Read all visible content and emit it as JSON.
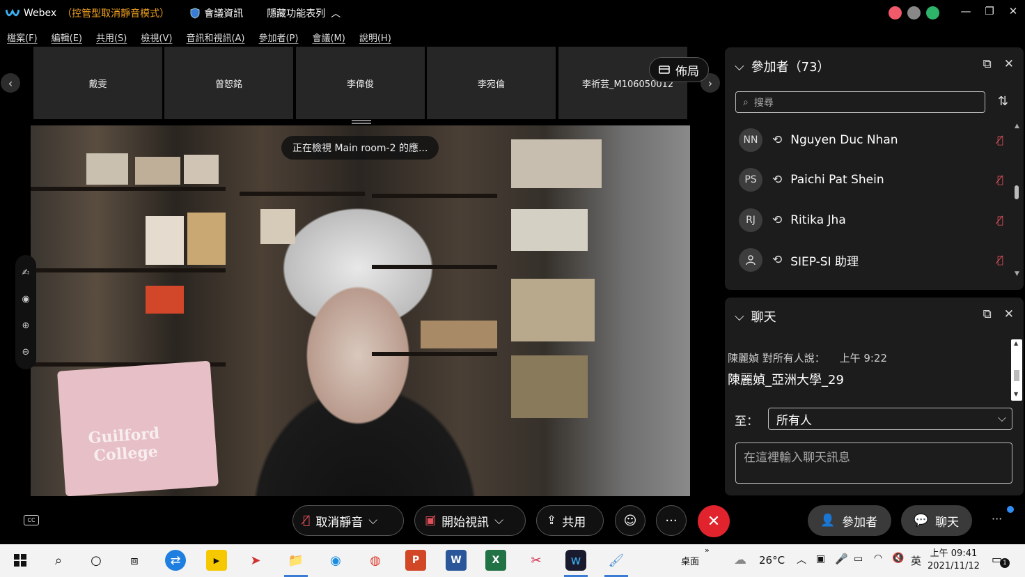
{
  "titlebar": {
    "app_name": "Webex",
    "mode": "（控管型取消靜音模式）",
    "meeting_info": "會議資訊",
    "hide_toolbar": "隱藏功能表列"
  },
  "menu": [
    "檔案(F)",
    "編輯(E)",
    "共用(S)",
    "檢視(V)",
    "音訊和視訊(A)",
    "參加者(P)",
    "會議(M)",
    "說明(H)"
  ],
  "thumbnails": [
    "戴雯",
    "曾恕銘",
    "李偉俊",
    "李宛倫",
    "李祈芸_M106050012"
  ],
  "layout_label": "佈局",
  "viewing_tip": "正在檢視 Main room-2 的應...",
  "video": {
    "shirt_line1": "Guilford",
    "shirt_line2": "College"
  },
  "participants": {
    "title": "參加者（73）",
    "search_placeholder": "搜尋",
    "list": [
      {
        "initials": "NN",
        "name": "Nguyen Duc Nhan"
      },
      {
        "initials": "PS",
        "name": "Paichi Pat Shein"
      },
      {
        "initials": "RJ",
        "name": "Ritika Jha"
      },
      {
        "initials": "",
        "name": "SIEP-SI 助理"
      }
    ]
  },
  "chat": {
    "title": "聊天",
    "sender_meta": "陳麗媜 對所有人說：",
    "time": "上午 9:22",
    "message": "陳麗媜_亞洲大學_29",
    "to_label": "至：",
    "to_value": "所有人",
    "input_placeholder": "在這裡輸入聊天訊息"
  },
  "controls": {
    "unmute": "取消靜音",
    "start_video": "開始視訊",
    "share": "共用",
    "participants": "參加者",
    "chat": "聊天"
  },
  "taskbar": {
    "desktop": "桌面",
    "temperature": "26°C",
    "ime": "英",
    "time": "上午 09:41",
    "date": "2021/11/12",
    "notification_count": "1"
  },
  "colors": {
    "accent_orange": "#f0a020",
    "mute_red": "#e0505a",
    "end_call": "#e0232d"
  }
}
